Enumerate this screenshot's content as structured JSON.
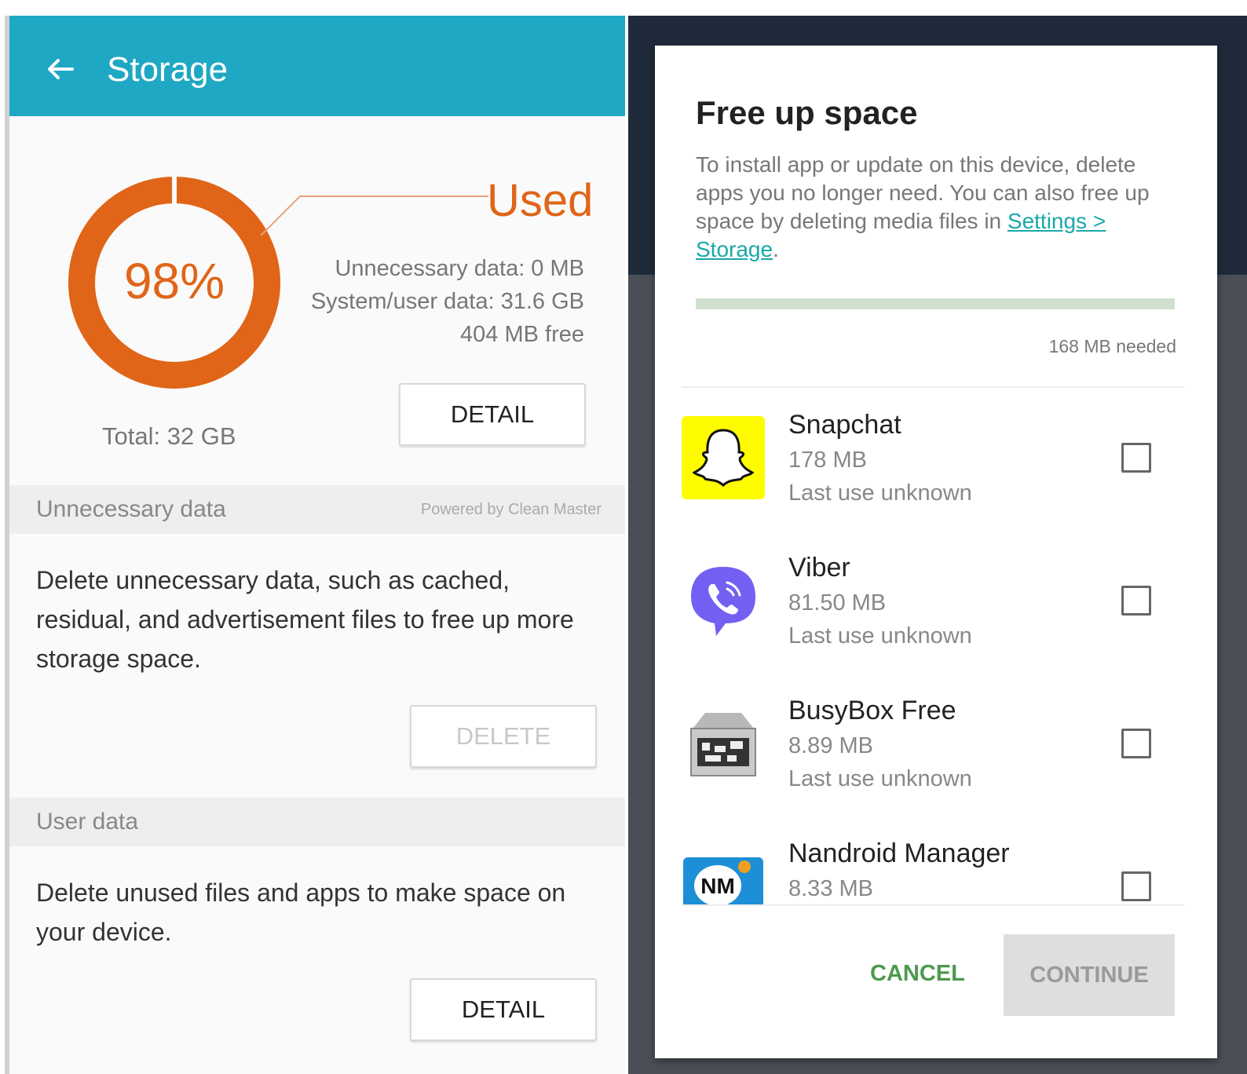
{
  "storage": {
    "title": "Storage",
    "used_label": "Used",
    "percent": "98%",
    "used_fraction": 0.98,
    "unnecessary_data": "Unnecessary data: 0 MB",
    "system_user_data": "System/user data: 31.6 GB",
    "free": "404 MB free",
    "total": "Total: 32 GB",
    "detail_button": "DETAIL",
    "sections": {
      "unnecessary": {
        "header": "Unnecessary data",
        "powered_by": "Powered by Clean Master",
        "description": "Delete unnecessary data, such as cached, residual, and advertisement files to free up more storage space.",
        "button": "DELETE"
      },
      "user": {
        "header": "User data",
        "description": "Delete unused files and apps to make space on your device.",
        "button": "DETAIL"
      }
    },
    "colors": {
      "accent": "#1ea8c4",
      "used": "#e06518"
    }
  },
  "dialog": {
    "title": "Free up space",
    "body": "To install app or update on this device, delete apps you no longer need. You can also free up space by deleting media files in",
    "link": "Settings > Storage",
    "link_suffix": ".",
    "progress": 0.0,
    "needed": "168 MB needed",
    "apps": [
      {
        "name": "Snapchat",
        "size": "178 MB",
        "last_use": "Last use unknown",
        "icon": "snapchat-icon"
      },
      {
        "name": "Viber",
        "size": "81.50 MB",
        "last_use": "Last use unknown",
        "icon": "viber-icon"
      },
      {
        "name": "BusyBox Free",
        "size": "8.89 MB",
        "last_use": "Last use unknown",
        "icon": "busybox-icon"
      },
      {
        "name": "Nandroid Manager",
        "size": "8.33 MB",
        "last_use": "",
        "icon": "nandroid-icon"
      }
    ],
    "cancel": "CANCEL",
    "continue": "CONTINUE"
  }
}
